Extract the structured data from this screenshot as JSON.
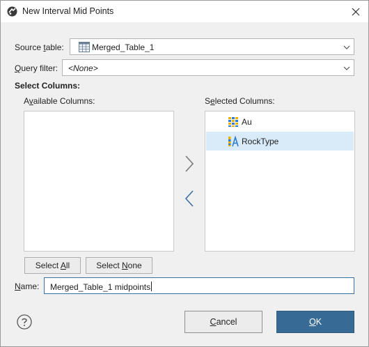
{
  "window": {
    "title": "New Interval Mid Points"
  },
  "form": {
    "source_table_label_pre": "Source ",
    "source_table_label_accel": "t",
    "source_table_label_post": "able:",
    "source_table_value": "Merged_Table_1",
    "query_filter_label_accel": "Q",
    "query_filter_label_post": "uery filter:",
    "query_filter_value": "<None>",
    "select_columns_heading": "Select Columns:",
    "available_label_pre": "A",
    "available_label_accel": "v",
    "available_label_post": "ailable Columns:",
    "selected_label_pre": "S",
    "selected_label_accel": "e",
    "selected_label_post": "lected Columns:",
    "name_label_accel": "N",
    "name_label_post": "ame:",
    "name_value": "Merged_Table_1 midpoints"
  },
  "available_columns": [],
  "selected_columns": [
    {
      "label": "Au",
      "icon": "numeric-column-icon",
      "selected": false
    },
    {
      "label": "RockType",
      "icon": "category-column-icon",
      "selected": true
    }
  ],
  "buttons": {
    "select_all_pre": "Select ",
    "select_all_accel": "A",
    "select_all_post": "ll",
    "select_none_pre": "Select ",
    "select_none_accel": "N",
    "select_none_post": "one",
    "cancel_accel": "C",
    "cancel_post": "ancel",
    "ok_accel": "O",
    "ok_post": "K"
  },
  "colors": {
    "accent": "#376b95",
    "selection": "#d9ebf9",
    "arrow_active": "#3b6fa0",
    "arrow_inactive": "#7a7a7a"
  }
}
